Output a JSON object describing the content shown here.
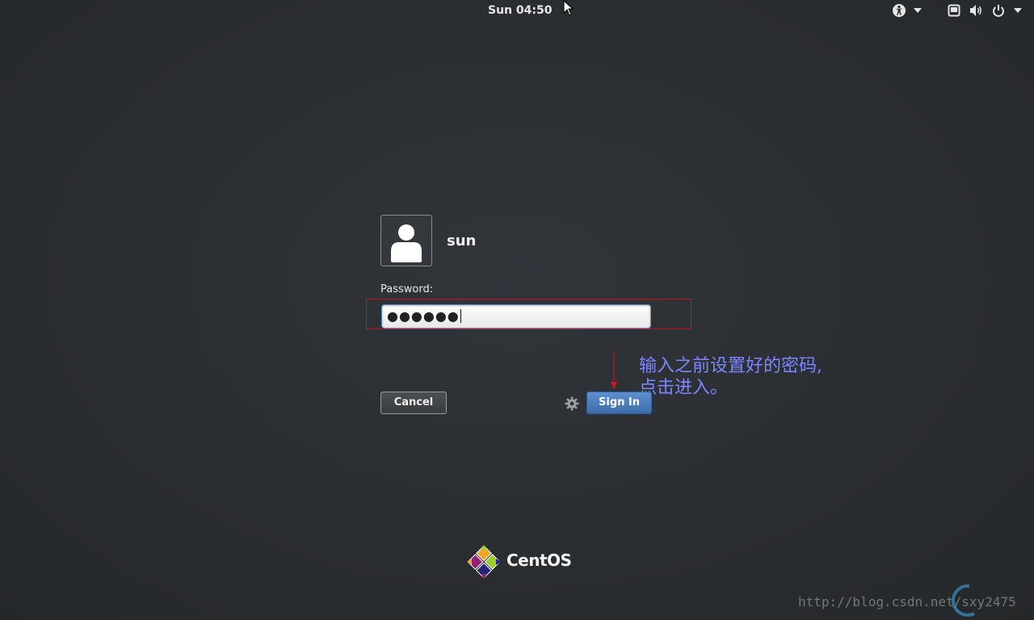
{
  "top_bar": {
    "clock": "Sun 04:50",
    "icons": [
      "accessibility-icon",
      "chevron-down-icon",
      "display-icon",
      "volume-icon",
      "power-icon",
      "chevron-down-icon"
    ]
  },
  "login": {
    "username": "sun",
    "password_label": "Password:",
    "password_mask": "●●●●●●",
    "cancel_label": "Cancel",
    "signin_label": "Sign In"
  },
  "annotation": {
    "line1": "输入之前设置好的密码,",
    "line2": "点击进入。",
    "color": "#7d86ff",
    "highlight_color": "#c4161c"
  },
  "branding": {
    "logo_text": "CentOS"
  },
  "watermark": {
    "url": "http://blog.csdn.net/sxy2475"
  }
}
